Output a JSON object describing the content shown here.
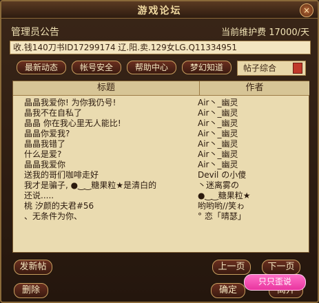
{
  "window": {
    "title": "游戏论坛",
    "close_label": "×"
  },
  "header": {
    "admin_label": "管理员公告",
    "fee_label": "当前维护费 17000/天"
  },
  "announcement": "收.钱140刀书ID17299174 辽.阳.卖.129女LG.Q11334951",
  "tabs": [
    {
      "label": "最新动态"
    },
    {
      "label": "帐号安全"
    },
    {
      "label": "帮助中心"
    },
    {
      "label": "梦幻知道"
    }
  ],
  "active_tab": "帖子综合",
  "table": {
    "headers": [
      "标题",
      "作者"
    ],
    "rows": [
      {
        "title": "晶晶我爱你! 为你我仍号!",
        "author": "Air丶_幽灵"
      },
      {
        "title": "晶我不在自私了",
        "author": "Air丶_幽灵"
      },
      {
        "title": "晶晶 你在我心里无人能比!",
        "author": "Air丶_幽灵"
      },
      {
        "title": "晶晶你爱我?",
        "author": "Air丶_幽灵"
      },
      {
        "title": "晶晶我错了",
        "author": "Air丶_幽灵"
      },
      {
        "title": "什么是爱?",
        "author": "Air丶_幽灵"
      },
      {
        "title": "晶晶我爱你",
        "author": "Air丶_幽灵"
      },
      {
        "title": "送我的哥们咖啡走好",
        "author": "Devil の小傻"
      },
      {
        "title": "我才是骗子, ●‿‿糖果粒★是清白的",
        "author": "丶迷离雾の"
      },
      {
        "title": "还说.....",
        "author": "●‿‿糖果粒★"
      },
      {
        "title": "桃 汐颜的夫君#56",
        "author": "哟哟哟//笑ゎ"
      },
      {
        "title": "、无条件为你、",
        "author": "° 恋「晴瑟」"
      }
    ]
  },
  "buttons": {
    "post": "发新帖",
    "delete": "删除",
    "prev": "上一页",
    "next": "下一页",
    "confirm": "确定",
    "leave": "离开",
    "popup": "只只歪说"
  }
}
